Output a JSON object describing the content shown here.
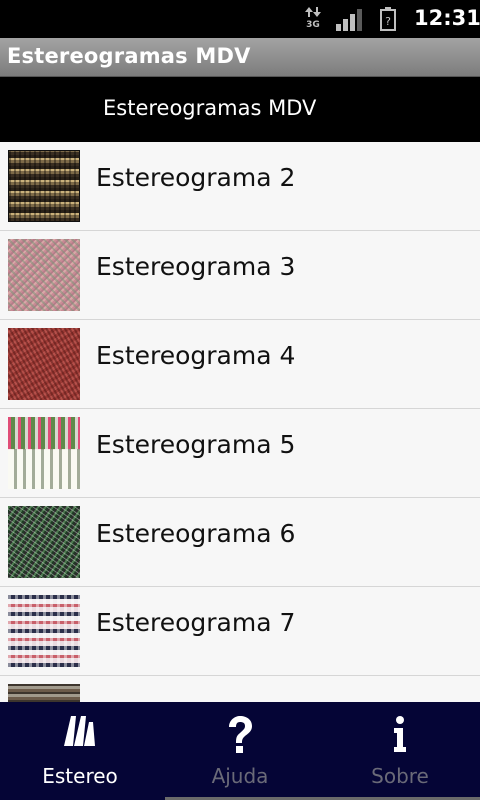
{
  "status_bar": {
    "network": "3G",
    "time": "12:31"
  },
  "title_bar": {
    "title": "Estereogramas MDV"
  },
  "header": {
    "title": "Estereogramas MDV"
  },
  "list": {
    "items": [
      {
        "label": "Estereograma 2"
      },
      {
        "label": "Estereograma 3"
      },
      {
        "label": "Estereograma 4"
      },
      {
        "label": "Estereograma 5"
      },
      {
        "label": "Estereograma 6"
      },
      {
        "label": "Estereograma 7"
      },
      {
        "label": ""
      }
    ]
  },
  "tabs": [
    {
      "label": "Estereo",
      "icon": "stereo-logo-icon",
      "selected": true
    },
    {
      "label": "Ajuda",
      "icon": "question-icon",
      "selected": false
    },
    {
      "label": "Sobre",
      "icon": "info-icon",
      "selected": false
    }
  ],
  "colors": {
    "tab_bar_bg": "#050536",
    "header_bg": "#000000",
    "list_bg": "#f7f7f7"
  }
}
